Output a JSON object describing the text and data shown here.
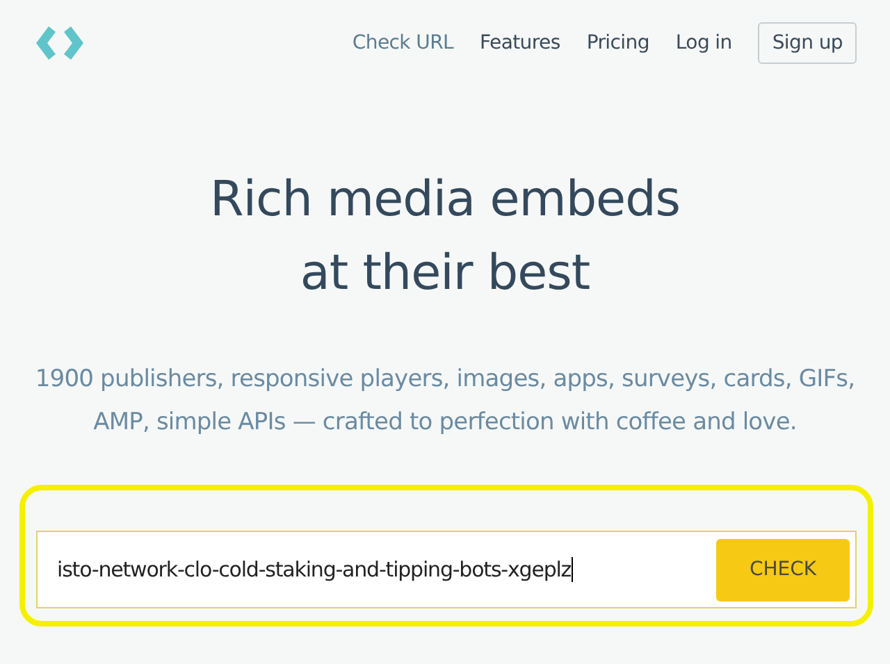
{
  "nav": [
    {
      "label": "Check URL",
      "selected": true
    },
    {
      "label": "Features",
      "selected": false
    },
    {
      "label": "Pricing",
      "selected": false
    },
    {
      "label": "Log in",
      "selected": false
    }
  ],
  "signup_button": "Sign up",
  "hero": {
    "title_lines": [
      "Rich media embeds",
      "at their best"
    ],
    "subtitle": "1900 publishers, responsive players, images, apps, surveys, cards, GIFs, AMP, simple APIs — crafted to perfection with coffee and love."
  },
  "url_form": {
    "value": "isto-network-clo-cold-staking-and-tipping-bots-xgeplz",
    "button": "CHECK"
  }
}
